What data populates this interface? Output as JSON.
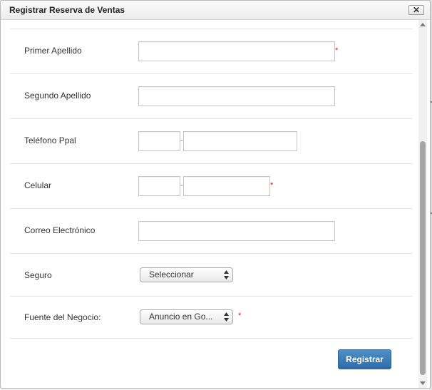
{
  "dialog": {
    "title": "Registrar Reserva de Ventas",
    "close_label": "✕"
  },
  "form": {
    "primer_apellido": {
      "label": "Primer Apellido",
      "value": "",
      "required_mark": "*"
    },
    "segundo_apellido": {
      "label": "Segundo Apellido",
      "value": ""
    },
    "telefono": {
      "label": "Teléfono Ppal",
      "area_value": "",
      "number_value": "",
      "separator": "-"
    },
    "celular": {
      "label": "Celular",
      "area_value": "",
      "number_value": "",
      "separator": "-",
      "required_mark": "*"
    },
    "correo": {
      "label": "Correo Electrónico",
      "value": ""
    },
    "seguro": {
      "label": "Seguro",
      "selected": "Seleccionar"
    },
    "fuente": {
      "label": "Fuente del Negocio:",
      "selected": "Anuncio en Go...",
      "required_mark": "*"
    },
    "submit_label": "Registrar"
  },
  "colors": {
    "primary_button": "#3a7cb5",
    "required": "#d9140f"
  }
}
